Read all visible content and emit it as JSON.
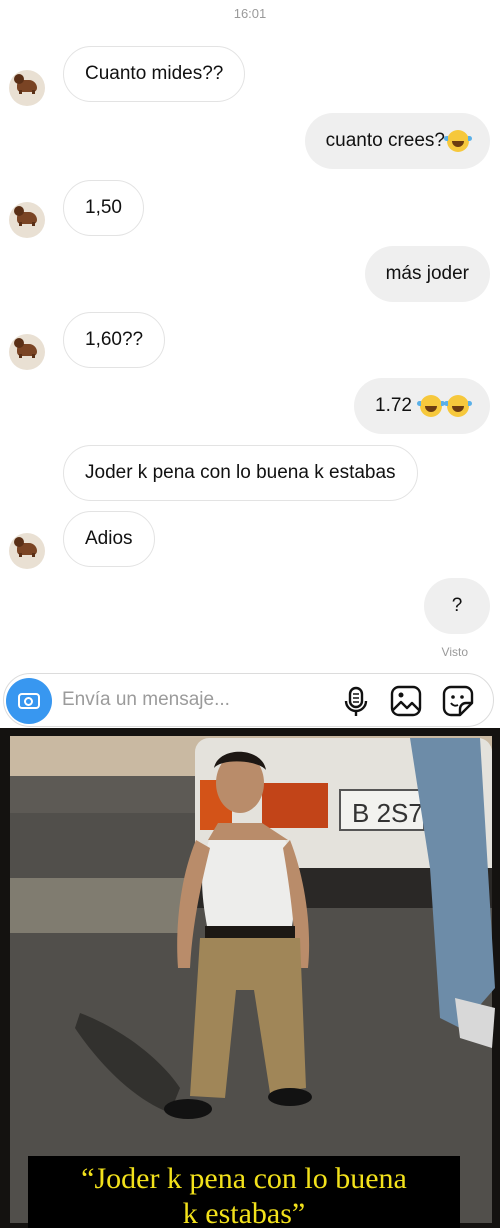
{
  "status": {
    "time": "16:01"
  },
  "messages": [
    {
      "side": "in",
      "text": "Cuanto mides??",
      "avatar": true
    },
    {
      "side": "out",
      "text": "cuanto crees?",
      "emoji": [
        "face-with-tears-of-joy"
      ]
    },
    {
      "side": "in",
      "text": "1,50",
      "avatar": true
    },
    {
      "side": "out",
      "text": "más joder"
    },
    {
      "side": "in",
      "text": "1,60??",
      "avatar": true
    },
    {
      "side": "out",
      "text": "1.72",
      "emoji": [
        "face-with-tears-of-joy",
        "face-with-tears-of-joy"
      ]
    },
    {
      "side": "in",
      "text": "Joder k pena con lo buena k estabas",
      "avatar": false
    },
    {
      "side": "in",
      "text": "Adios",
      "avatar": true
    },
    {
      "side": "out",
      "text": "?"
    }
  ],
  "seen_label": "Visto",
  "composer": {
    "placeholder": "Envía un mensaje...",
    "icons": [
      "camera-icon",
      "microphone-icon",
      "gallery-icon",
      "sticker-icon"
    ]
  },
  "meme": {
    "caption_line1": "“Joder k pena con lo buena",
    "caption_line2": "k estabas”",
    "plate": "B 2S7",
    "caption_color": "#f2e11b"
  },
  "colors": {
    "camera": "#3897f0",
    "outgoing": "#efefef",
    "incoming_border": "#e3e3e3"
  }
}
